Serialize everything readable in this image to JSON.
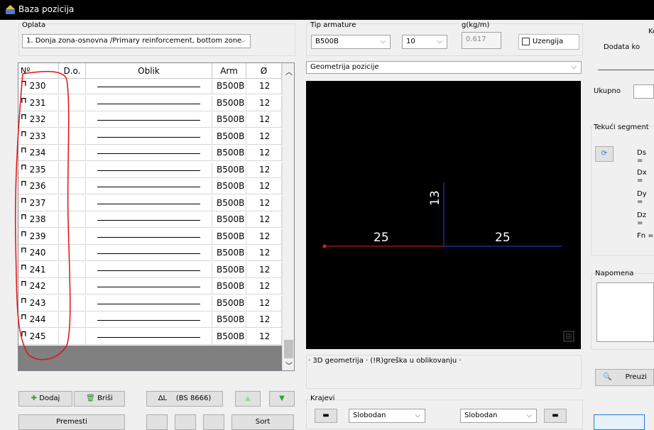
{
  "window": {
    "title": "Baza pozicija"
  },
  "oplata": {
    "label": "Oplata",
    "value": "1. Donja zona-osnovna /Primary reinforcement, bottom zone"
  },
  "armature": {
    "tip_label": "Tip armature",
    "tip_value": "B500B",
    "diameter_value": "10",
    "g_label": "g(kg/m)",
    "g_value": "0.617",
    "uzengija_label": "Uzengija"
  },
  "right_panel": {
    "ko": "Ko",
    "dodata": "Dodata ko",
    "ukupno": "Ukupno",
    "tekuci_segment": "Tekući segment",
    "ds": "Ds =",
    "dx": "Dx =",
    "dy": "Dy =",
    "dz": "Dz =",
    "fn": "Fn =",
    "napomena": "Napomena",
    "preuzmi": "Preuzi"
  },
  "table": {
    "headers": {
      "no": "Nº",
      "do": "D.o.",
      "oblik": "Oblik",
      "arm": "Arm",
      "dia": "Ø"
    },
    "rows": [
      {
        "no": "230",
        "arm": "B500B",
        "dia": "12"
      },
      {
        "no": "231",
        "arm": "B500B",
        "dia": "12"
      },
      {
        "no": "232",
        "arm": "B500B",
        "dia": "12"
      },
      {
        "no": "233",
        "arm": "B500B",
        "dia": "12"
      },
      {
        "no": "234",
        "arm": "B500B",
        "dia": "12"
      },
      {
        "no": "235",
        "arm": "B500B",
        "dia": "12"
      },
      {
        "no": "236",
        "arm": "B500B",
        "dia": "12"
      },
      {
        "no": "237",
        "arm": "B500B",
        "dia": "12"
      },
      {
        "no": "238",
        "arm": "B500B",
        "dia": "12"
      },
      {
        "no": "239",
        "arm": "B500B",
        "dia": "12"
      },
      {
        "no": "240",
        "arm": "B500B",
        "dia": "12"
      },
      {
        "no": "241",
        "arm": "B500B",
        "dia": "12"
      },
      {
        "no": "242",
        "arm": "B500B",
        "dia": "12"
      },
      {
        "no": "243",
        "arm": "B500B",
        "dia": "12"
      },
      {
        "no": "244",
        "arm": "B500B",
        "dia": "12"
      },
      {
        "no": "245",
        "arm": "B500B",
        "dia": "12"
      }
    ]
  },
  "buttons": {
    "dodaj": "Dodaj",
    "brisi": "Briši",
    "delta_l": "ΔL",
    "bs": "(BS 8666)",
    "premesti": "Premesti",
    "sort": "Sort"
  },
  "geometry": {
    "select_value": "Geometrija pozicije",
    "labels": {
      "left": "25",
      "right": "25",
      "vertical": "13"
    },
    "status": "· 3D geometrija · (!R)greška u oblikovanju ·"
  },
  "krajevi": {
    "label": "Krajevi",
    "left_value": "Slobodan",
    "right_value": "Slobodan"
  }
}
